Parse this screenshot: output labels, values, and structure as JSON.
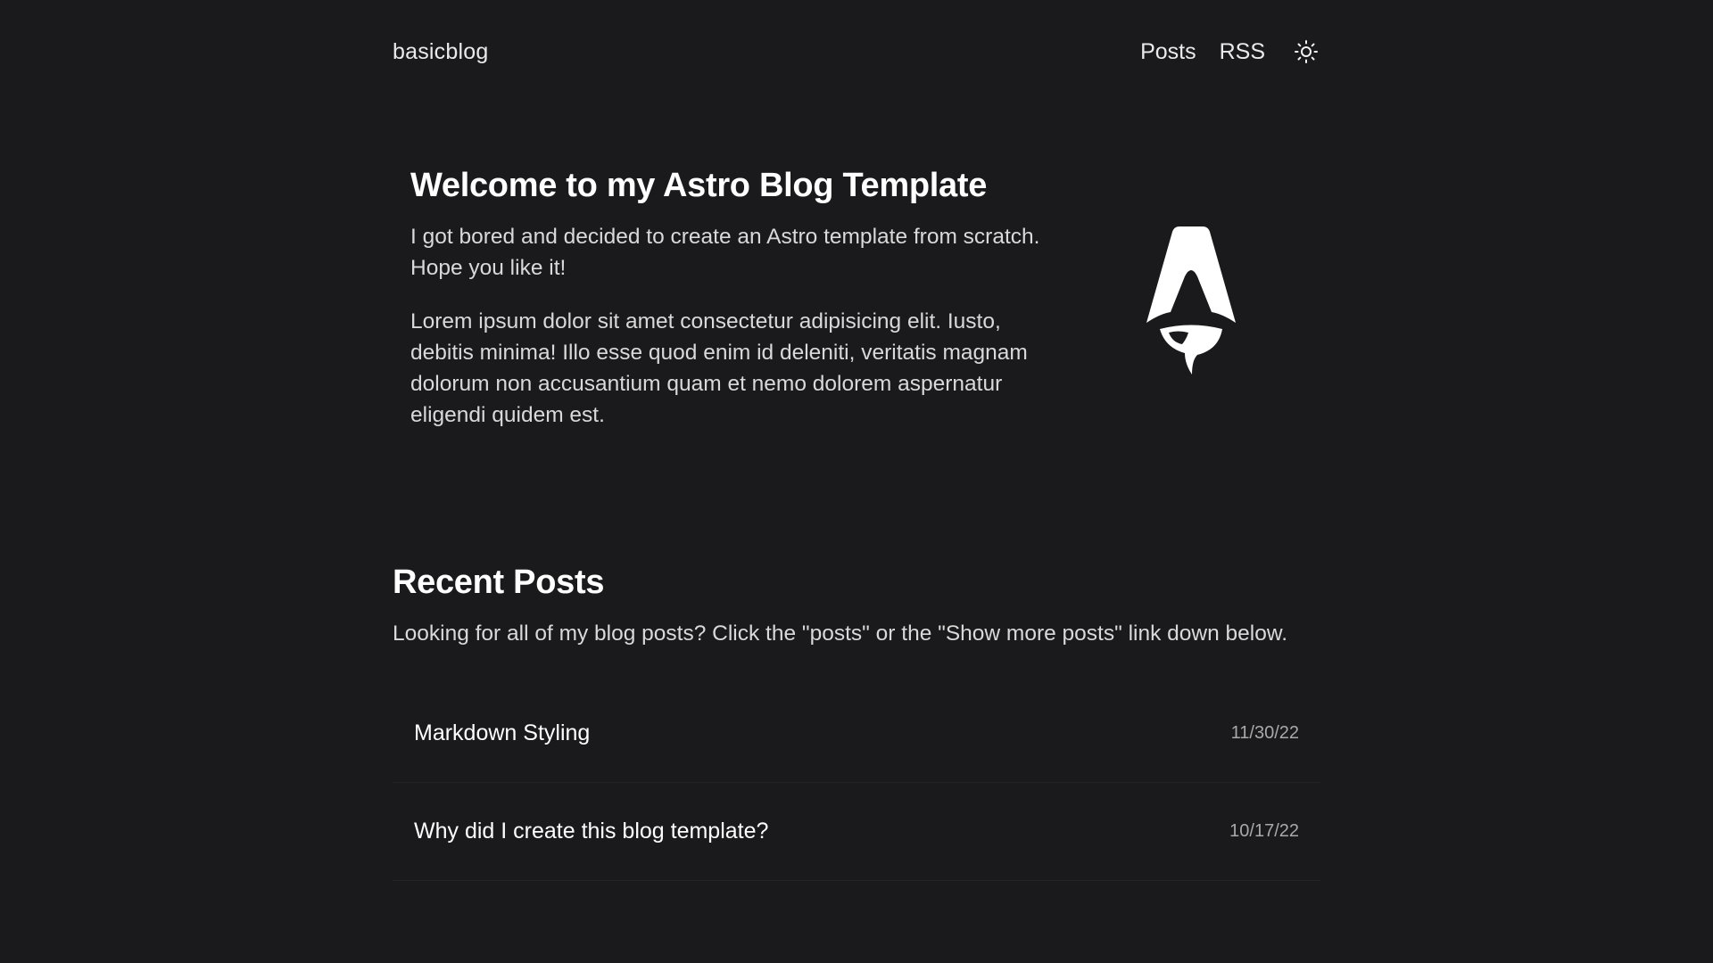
{
  "header": {
    "brand": "basicblog",
    "nav": [
      {
        "label": "Posts"
      },
      {
        "label": "RSS"
      }
    ],
    "theme_toggle_icon": "sun-icon"
  },
  "hero": {
    "title": "Welcome to my Astro Blog Template",
    "paragraphs": [
      "I got bored and decided to create an Astro template from scratch. Hope you like it!",
      "Lorem ipsum dolor sit amet consectetur adipisicing elit. Iusto, debitis minima! Illo esse quod enim id deleniti, veritatis magnam dolorum non accusantium quam et nemo dolorem aspernatur eligendi quidem est."
    ],
    "logo_icon": "astro-rocket-logo"
  },
  "recent": {
    "title": "Recent Posts",
    "description": "Looking for all of my blog posts? Click the \"posts\" or the \"Show more posts\" link down below.",
    "posts": [
      {
        "title": "Markdown Styling",
        "date": "11/30/22"
      },
      {
        "title": "Why did I create this blog template?",
        "date": "10/17/22"
      }
    ]
  },
  "colors": {
    "background": "#1a1a1c",
    "text": "#f2f2f2",
    "muted": "#a9a9a9"
  }
}
